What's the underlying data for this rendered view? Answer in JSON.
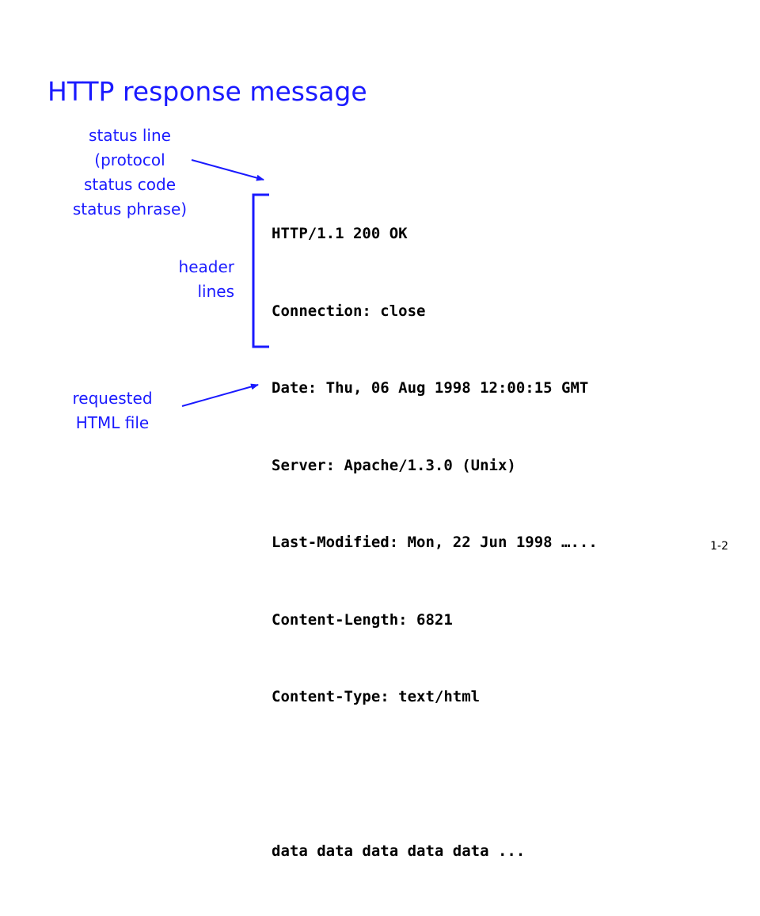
{
  "slide": {
    "title": "HTTP response message",
    "page_number": "1-2",
    "accent_color": "#1a1aff",
    "annotations": {
      "status_line": [
        "status line",
        "(protocol",
        "status code",
        "status phrase)"
      ],
      "header_lines": [
        "header",
        "lines"
      ],
      "requested_file": [
        "requested",
        "HTML file"
      ]
    },
    "message": {
      "status_line": "HTTP/1.1 200 OK",
      "header_lines": [
        "Connection: close",
        "Date: Thu, 06 Aug 1998 12:00:15 GMT",
        "Server: Apache/1.3.0 (Unix)",
        "Last-Modified: Mon, 22 Jun 1998 …...",
        "Content-Length: 6821",
        "Content-Type: text/html"
      ],
      "body": "data data data data data ..."
    }
  }
}
